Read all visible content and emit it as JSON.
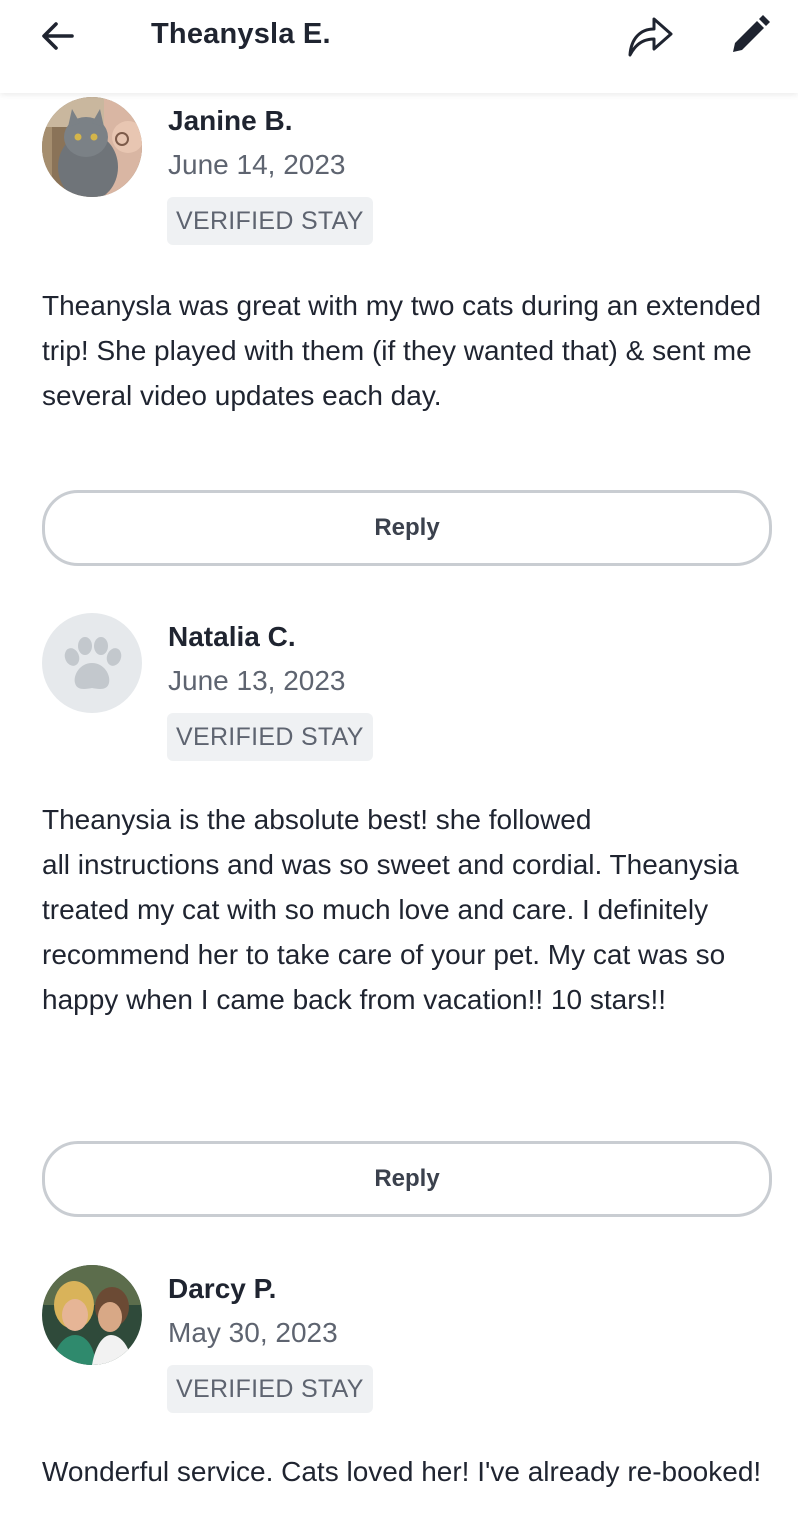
{
  "header": {
    "title": "Theanysla E.",
    "back_icon": "arrow-left-icon",
    "share_icon": "share-icon",
    "edit_icon": "pencil-icon"
  },
  "reviews": [
    {
      "name": "Janine B.",
      "date": "June 14, 2023",
      "badge": "VERIFIED STAY",
      "text": "Theanysla was great with my two cats during an extended trip! She played with them (if they wanted that) & sent me several video updates each day.",
      "reply_label": "Reply",
      "avatar": "photo"
    },
    {
      "name": "Natalia C.",
      "date": "June 13, 2023",
      "badge": "VERIFIED STAY",
      "text": "Theanysia is the absolute best!  she followed\nall instructions and was so sweet and cordial. Theanysia treated my cat with so much love and care. I definitely recommend her to take care of your pet. My cat was so happy when I came back from vacation!! 10 stars!!",
      "reply_label": "Reply",
      "avatar": "paw-placeholder"
    },
    {
      "name": "Darcy P.",
      "date": "May 30, 2023",
      "badge": "VERIFIED STAY",
      "text": "Wonderful service. Cats loved her! I've already re-booked!",
      "avatar": "photo"
    }
  ],
  "colors": {
    "text_primary": "#1f2430",
    "text_secondary": "#5e6470",
    "badge_bg": "#eff1f3",
    "button_border": "#c9cdd2"
  }
}
